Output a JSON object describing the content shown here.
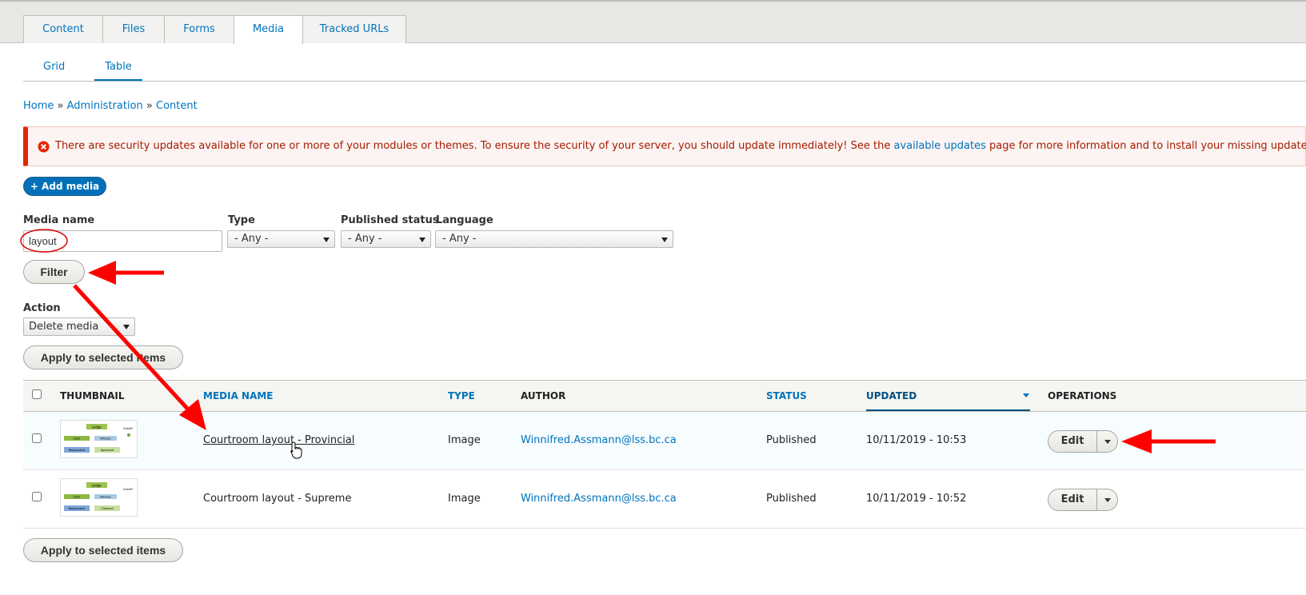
{
  "primary_tabs": [
    "Content",
    "Files",
    "Forms",
    "Media",
    "Tracked URLs"
  ],
  "secondary_tabs": [
    "Grid",
    "Table"
  ],
  "breadcrumb": [
    "Home",
    "Administration",
    "Content"
  ],
  "breadcrumb_sep": "»",
  "message": {
    "before": "There are security updates available for one or more of your modules or themes. To ensure the security of your server, you should update immediately! See the ",
    "link": "available updates",
    "after": " page for more information and to install your missing updates."
  },
  "add_media_label": "+ Add media",
  "filters": {
    "media_name_label": "Media name",
    "media_name_value": "layout",
    "type_label": "Type",
    "type_value": "- Any -",
    "status_label": "Published status",
    "status_value": "- Any -",
    "language_label": "Language",
    "language_value": "- Any -",
    "filter_button": "Filter"
  },
  "action": {
    "label": "Action",
    "value": "Delete media",
    "apply_label": "Apply to selected items"
  },
  "table": {
    "headers": [
      "THUMBNAIL",
      "MEDIA NAME",
      "TYPE",
      "AUTHOR",
      "STATUS",
      "UPDATED",
      "OPERATIONS"
    ],
    "rows": [
      {
        "name": "Courtroom layout - Provincial",
        "type": "Image",
        "author": "Winnifred.Assmann@lss.bc.ca",
        "status": "Published",
        "updated": "10/11/2019 - 10:53",
        "op": "Edit",
        "thumb": {
          "judge": "Judge",
          "sheriff": "Sheriff",
          "clerk": "Clerk",
          "witness": "Witness",
          "left_party": "Respondent",
          "right_party": "Applicant"
        }
      },
      {
        "name": "Courtroom layout - Supreme",
        "type": "Image",
        "author": "Winnifred.Assmann@lss.bc.ca",
        "status": "Published",
        "updated": "10/11/2019 - 10:52",
        "op": "Edit",
        "thumb": {
          "judge": "Judge",
          "sheriff": "Sheriff",
          "clerk": "Clerk",
          "witness": "Witness",
          "left_party": "Respondent",
          "right_party": "Claimant"
        }
      }
    ]
  },
  "apply_bottom_label": "Apply to selected items",
  "colors": {
    "link": "#0074bd",
    "primary_button": "#0071b8",
    "error": "#e62600",
    "annotation": "#ff0000"
  }
}
